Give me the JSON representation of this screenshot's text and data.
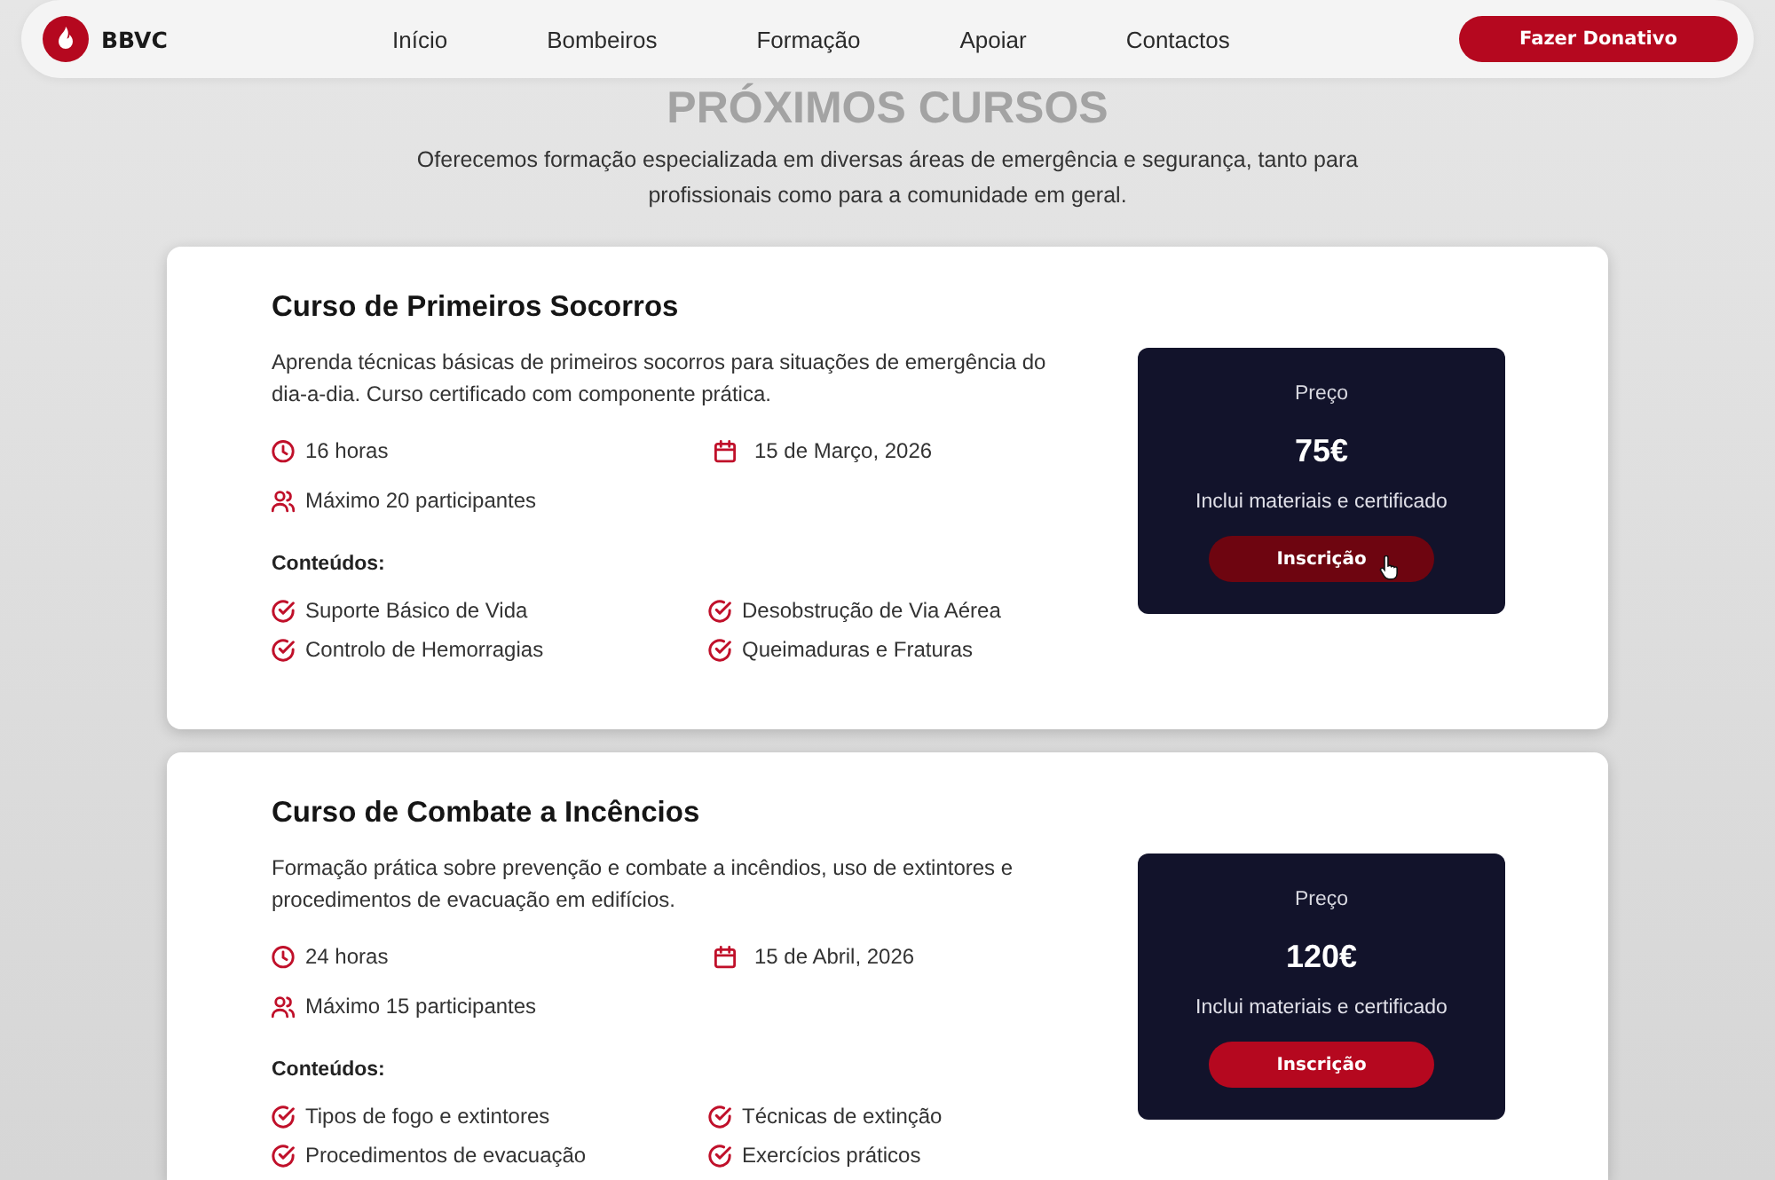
{
  "nav": {
    "logo_text": "BBVC",
    "links": [
      "Início",
      "Bombeiros",
      "Formação",
      "Apoiar",
      "Contactos"
    ],
    "cta": "Fazer Donativo"
  },
  "heading": "PRÓXIMOS CURSOS",
  "subtitle": "Oferecemos formação especializada em diversas áreas de emergência e segurança, tanto para profissionais como para a comunidade em geral.",
  "courses": [
    {
      "title": "Curso de Primeiros Socorros",
      "description": "Aprenda técnicas básicas de primeiros socorros para situações de emergência do dia-a-dia. Curso certificado com componente prática.",
      "meta": [
        {
          "kind": "duration",
          "text": "16 horas"
        },
        {
          "kind": "date",
          "text": "15 de Março, 2026"
        },
        {
          "kind": "participants",
          "text": "Máximo 20 participantes"
        }
      ],
      "contents_label": "Conteúdos:",
      "contents": [
        "Suporte Básico de Vida",
        "Desobstrução de Via Aérea",
        "Controlo de Hemorragias",
        "Queimaduras e Fraturas"
      ],
      "price_label": "Preço",
      "price": "75€",
      "price_note": "Inclui materiais e certificado",
      "button": {
        "label": "Inscrição",
        "hovered": true
      }
    },
    {
      "title": "Curso de Combate a Incêncios",
      "description": "Formação prática sobre prevenção e combate a incêndios, uso de extintores e procedimentos de evacuação em edifícios.",
      "meta": [
        {
          "kind": "duration",
          "text": "24 horas"
        },
        {
          "kind": "date",
          "text": "15 de Abril, 2026"
        },
        {
          "kind": "participants",
          "text": "Máximo 15 participantes"
        }
      ],
      "contents_label": "Conteúdos:",
      "contents": [
        "Tipos de fogo e extintores",
        "Técnicas de extinção",
        "Procedimentos de evacuação",
        "Exercícios práticos"
      ],
      "price_label": "Preço",
      "price": "120€",
      "price_note": "Inclui materiais e certificado",
      "button": {
        "label": "Inscrição",
        "hovered": false
      }
    }
  ]
}
